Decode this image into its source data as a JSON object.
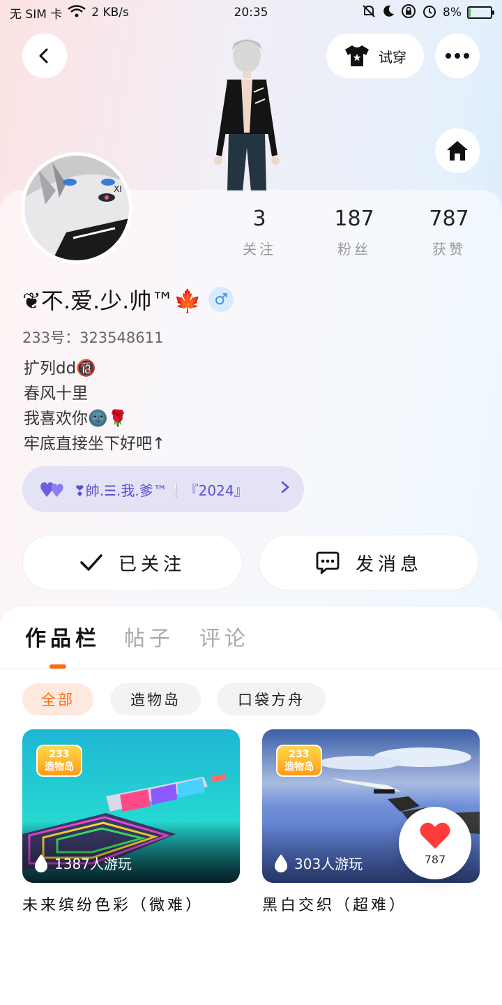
{
  "status_bar": {
    "carrier": "无 SIM 卡",
    "speed": "2 KB/s",
    "time": "20:35",
    "battery": "8%",
    "battery_level": 0.08
  },
  "header": {
    "back_icon": "chevron-left-icon",
    "tryon_label": "试穿",
    "more_icon": "more-dots-icon",
    "home_icon": "home-icon"
  },
  "stats": [
    {
      "value": "3",
      "label": "关注"
    },
    {
      "value": "187",
      "label": "粉丝"
    },
    {
      "value": "787",
      "label": "获赞"
    }
  ],
  "profile": {
    "name": "❦不.爱.少.帅™🍁",
    "gender": "♂",
    "uid": "233号：323548611",
    "bio": [
      "扩列dd🔞",
      "春风十里",
      "我喜欢你🌚🌹",
      "牢底直接坐下好吧↑"
    ]
  },
  "group": {
    "label": "❣帥.☰.我.爹™❕『2024』",
    "accent": "#5a4fd0"
  },
  "actions": {
    "follow_label": "已关注",
    "message_label": "发消息"
  },
  "tabs": [
    "作品栏",
    "帖子",
    "评论"
  ],
  "filters": [
    "全部",
    "造物岛",
    "口袋方舟"
  ],
  "games": [
    {
      "title": "未来缤纷色彩（微难）",
      "plays": "1387人游玩",
      "logo_top": "233",
      "logo_bottom": "造物岛"
    },
    {
      "title": "黑白交织（超难）",
      "plays": "303人游玩",
      "logo_top": "233",
      "logo_bottom": "造物岛"
    }
  ],
  "like": {
    "count": "787"
  },
  "colors": {
    "accent": "#ff6a13",
    "heart": "#ff3b3b",
    "gender": "#3b8ee8"
  }
}
